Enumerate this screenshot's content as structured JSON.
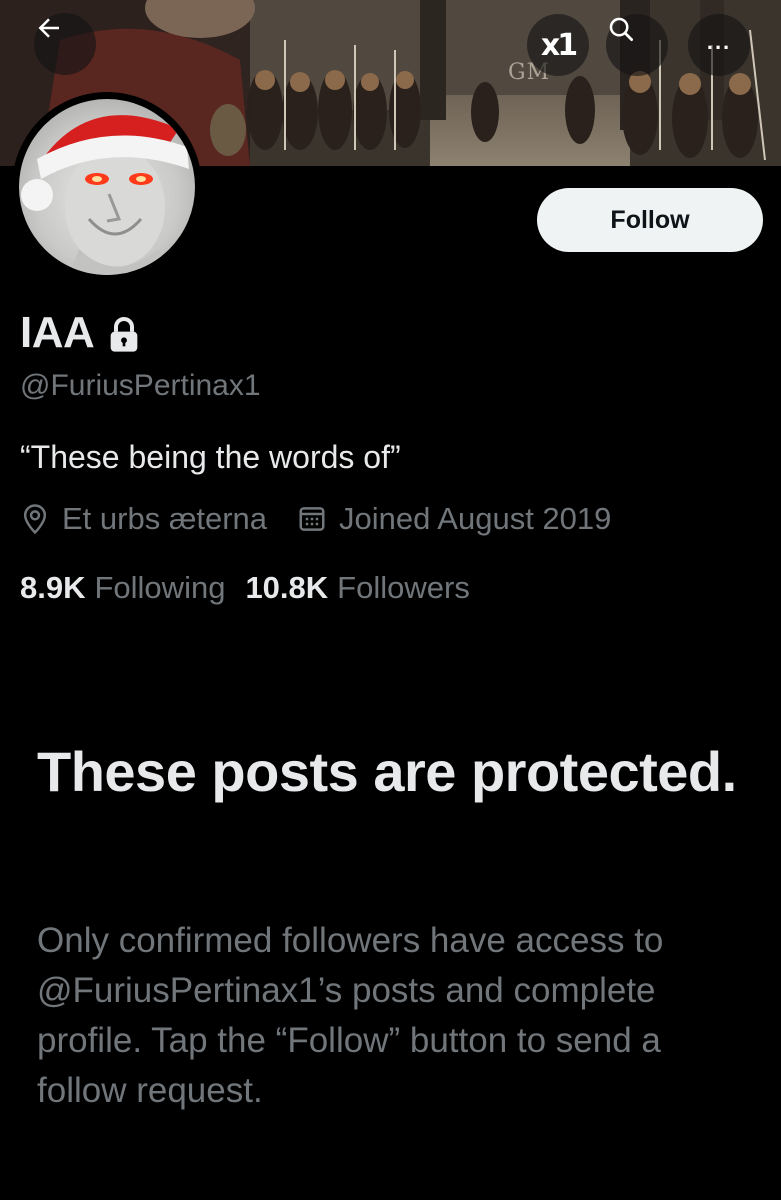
{
  "banner": {
    "watermark": "GM"
  },
  "header": {
    "back_icon": "arrow-left-icon",
    "x1_label": "x1",
    "search_icon": "search-icon",
    "more_label": "..."
  },
  "profile": {
    "name": "IAA",
    "handle": "@FuriusPertinax1",
    "bio": "“These being the words of”",
    "location": "Et urbs æterna",
    "joined": "Joined August 2019",
    "following_count": "8.9K",
    "following_label": "Following",
    "followers_count": "10.8K",
    "followers_label": "Followers",
    "follow_button": "Follow"
  },
  "protected": {
    "title": "These posts are protected.",
    "body": "Only confirmed followers have access to @FuriusPertinax1’s posts and complete profile. Tap the “Follow” button to send a follow request."
  }
}
